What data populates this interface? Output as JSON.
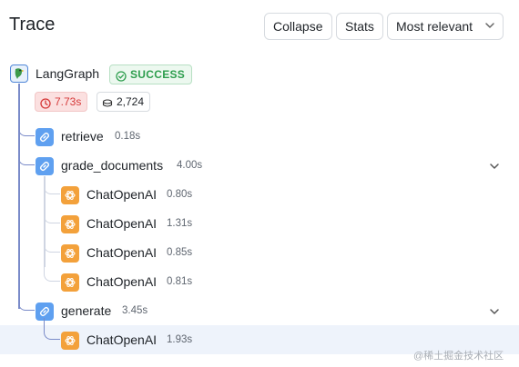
{
  "header": {
    "title": "Trace",
    "collapse_label": "Collapse",
    "stats_label": "Stats",
    "sort_label": "Most relevant"
  },
  "root": {
    "name": "LangGraph",
    "status": "SUCCESS",
    "latency": "7.73s",
    "tokens": "2,724",
    "icon": "parrot-icon"
  },
  "runs": [
    {
      "name": "retrieve",
      "duration": "0.18s",
      "type": "chain",
      "icon": "link-icon"
    },
    {
      "name": "grade_documents",
      "duration": "4.00s",
      "type": "chain",
      "icon": "link-icon",
      "expandable": true
    },
    {
      "name": "ChatOpenAI",
      "duration": "0.80s",
      "type": "llm",
      "icon": "openai-icon"
    },
    {
      "name": "ChatOpenAI",
      "duration": "1.31s",
      "type": "llm",
      "icon": "openai-icon"
    },
    {
      "name": "ChatOpenAI",
      "duration": "0.85s",
      "type": "llm",
      "icon": "openai-icon"
    },
    {
      "name": "ChatOpenAI",
      "duration": "0.81s",
      "type": "llm",
      "icon": "openai-icon"
    },
    {
      "name": "generate",
      "duration": "3.45s",
      "type": "chain",
      "icon": "link-icon",
      "expandable": true
    },
    {
      "name": "ChatOpenAI",
      "duration": "1.93s",
      "type": "llm",
      "icon": "openai-icon",
      "selected": true
    }
  ],
  "watermark": "@稀土掘金技术社区",
  "colors": {
    "chain": "#5fa0f0",
    "llm": "#f3a13b",
    "success": "#2e9e4e",
    "latency": "#d63939",
    "selected_row": "#eef3fb",
    "connector": "#7a8bc9"
  }
}
